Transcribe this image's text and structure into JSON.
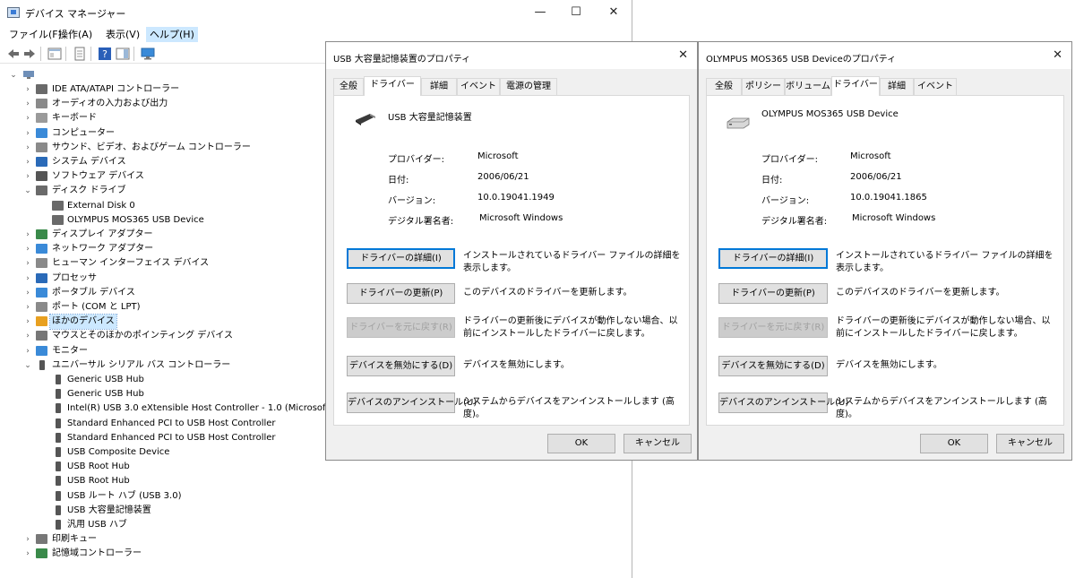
{
  "device_manager": {
    "title": "デバイス マネージャー",
    "window_controls": {
      "minimize": "—",
      "maximize": "☐",
      "close": "✕"
    },
    "menu": [
      "ファイル(F)",
      "操作(A)",
      "表示(V)",
      "ヘルプ(H)"
    ],
    "tree": [
      "IDE ATA/ATAPI コントローラー",
      "オーディオの入力および出力",
      "キーボード",
      "コンピューター",
      "サウンド、ビデオ、およびゲーム コントローラー",
      "システム デバイス",
      "ソフトウェア デバイス",
      "ディスク ドライブ",
      "External Disk 0",
      "OLYMPUS MOS365 USB Device",
      "ディスプレイ アダプター",
      "ネットワーク アダプター",
      "ヒューマン インターフェイス デバイス",
      "プロセッサ",
      "ポータブル デバイス",
      "ポート (COM と LPT)",
      "ほかのデバイス",
      "マウスとそのほかのポインティング デバイス",
      "モニター",
      "ユニバーサル シリアル バス コントローラー",
      "Generic USB Hub",
      "Generic USB Hub",
      "Intel(R) USB 3.0 eXtensible Host Controller - 1.0 (Microsoft)",
      "Standard Enhanced PCI to USB Host Controller",
      "Standard Enhanced PCI to USB Host Controller",
      "USB Composite Device",
      "USB Root Hub",
      "USB Root Hub",
      "USB ルート ハブ (USB 3.0)",
      "USB 大容量記憶装置",
      "汎用 USB ハブ",
      "印刷キュー",
      "記憶域コントローラー"
    ]
  },
  "dialog1": {
    "title": "USB 大容量記憶装置のプロパティ",
    "close": "✕",
    "tabs": [
      "全般",
      "ドライバー",
      "詳細",
      "イベント",
      "電源の管理"
    ],
    "device_name": "USB 大容量記憶装置",
    "provider_label": "プロバイダー:",
    "provider": "Microsoft",
    "date_label": "日付:",
    "date": "2006/06/21",
    "version_label": "バージョン:",
    "version": "10.0.19041.1949",
    "signer_label": "デジタル署名者:",
    "signer": "Microsoft Windows",
    "buttons": [
      "ドライバーの詳細(I)",
      "ドライバーの更新(P)",
      "ドライバーを元に戻す(R)",
      "デバイスを無効にする(D)",
      "デバイスのアンインストール(U)"
    ],
    "descriptions": [
      "インストールされているドライバー ファイルの詳細を表示します。",
      "このデバイスのドライバーを更新します。",
      "ドライバーの更新後にデバイスが動作しない場合、以前にインストールしたドライバーに戻します。",
      "デバイスを無効にします。",
      "システムからデバイスをアンインストールします (高度)。"
    ],
    "ok": "OK",
    "cancel": "キャンセル"
  },
  "dialog2": {
    "title": "OLYMPUS MOS365 USB Deviceのプロパティ",
    "close": "✕",
    "tabs": [
      "全般",
      "ポリシー",
      "ボリューム",
      "ドライバー",
      "詳細",
      "イベント"
    ],
    "device_name": "OLYMPUS MOS365 USB Device",
    "provider_label": "プロバイダー:",
    "provider": "Microsoft",
    "date_label": "日付:",
    "date": "2006/06/21",
    "version_label": "バージョン:",
    "version": "10.0.19041.1865",
    "signer_label": "デジタル署名者:",
    "signer": "Microsoft Windows",
    "buttons": [
      "ドライバーの詳細(I)",
      "ドライバーの更新(P)",
      "ドライバーを元に戻す(R)",
      "デバイスを無効にする(D)",
      "デバイスのアンインストール(U)"
    ],
    "descriptions": [
      "インストールされているドライバー ファイルの詳細を表示します。",
      "このデバイスのドライバーを更新します。",
      "ドライバーの更新後にデバイスが動作しない場合、以前にインストールしたドライバーに戻します。",
      "デバイスを無効にします。",
      "システムからデバイスをアンインストールします (高度)。"
    ],
    "ok": "OK",
    "cancel": "キャンセル"
  }
}
